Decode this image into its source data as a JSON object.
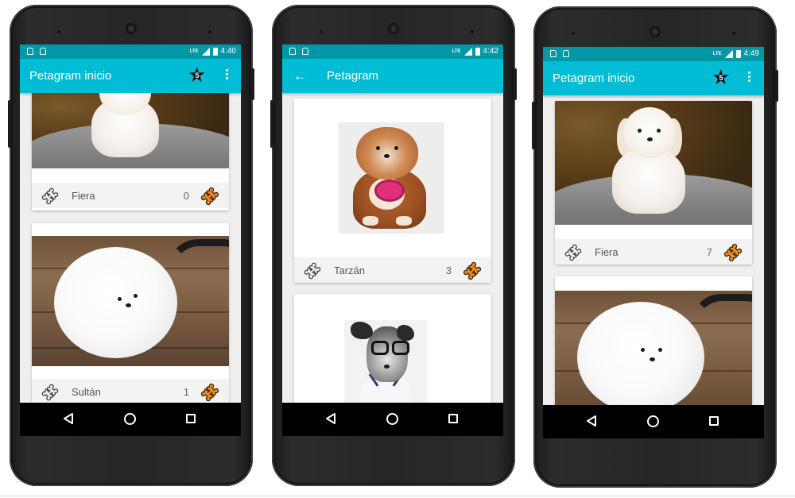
{
  "colors": {
    "primary": "#00bcd4",
    "primary_dark": "#0097a7",
    "accent_bone": "#f58a1f",
    "nav_bg": "#000000"
  },
  "phones": [
    {
      "status": {
        "network": "LTE",
        "time": "4:40"
      },
      "appbar": {
        "title": "Petagram inicio",
        "has_back": false,
        "star_badge": "5",
        "star_icon": "star-icon",
        "menu_icon": "more-vert-icon"
      },
      "cards": [
        {
          "name": "Fiera",
          "count": "0",
          "like_icon": "bone-outline-icon",
          "rate_icon": "bone-orange-icon"
        },
        {
          "name": "Sultán",
          "count": "1",
          "like_icon": "bone-outline-icon",
          "rate_icon": "bone-orange-icon"
        }
      ]
    },
    {
      "status": {
        "network": "LTE",
        "time": "4:42"
      },
      "appbar": {
        "title": "Petagram",
        "has_back": true,
        "back_icon": "arrow-back-icon"
      },
      "cards": [
        {
          "name": "Tarzán",
          "count": "3",
          "like_icon": "bone-outline-icon",
          "rate_icon": "bone-orange-icon"
        }
      ]
    },
    {
      "status": {
        "network": "LTE",
        "time": "4:49"
      },
      "appbar": {
        "title": "Petagram inicio",
        "has_back": false,
        "star_badge": "5",
        "star_icon": "star-icon",
        "menu_icon": "more-vert-icon"
      },
      "cards": [
        {
          "name": "Fiera",
          "count": "7",
          "like_icon": "bone-outline-icon",
          "rate_icon": "bone-orange-icon"
        }
      ]
    }
  ],
  "navbar": {
    "back_icon": "nav-back-icon",
    "home_icon": "nav-home-icon",
    "recents_icon": "nav-recents-icon"
  }
}
